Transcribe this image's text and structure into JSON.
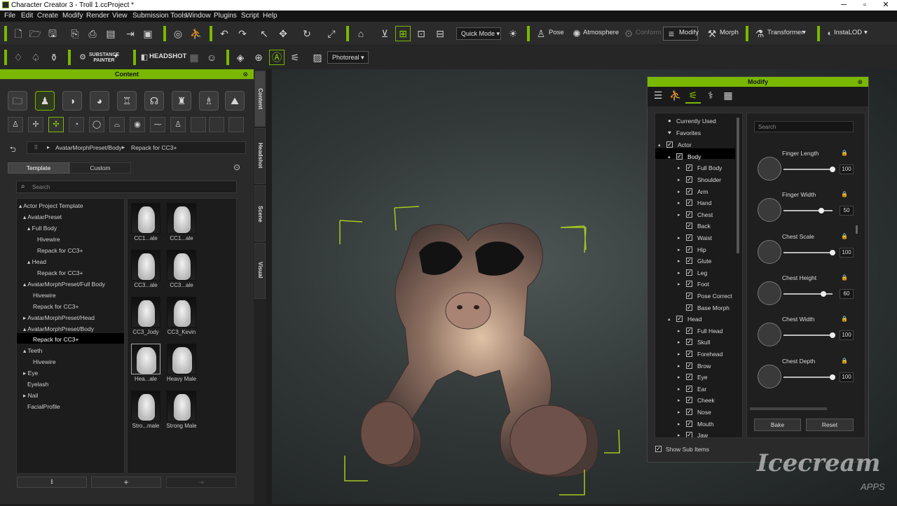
{
  "window": {
    "title": "Character Creator 3 - Troll 1.ccProject *"
  },
  "menu": [
    "File",
    "Edit",
    "Create",
    "Modify",
    "Render",
    "View",
    "Submission Tools",
    "Window",
    "Plugins",
    "Script",
    "Help"
  ],
  "toolbar1": {
    "quick_mode": "Quick Mode",
    "pose": "Pose",
    "atmosphere": "Atmosphere",
    "conform": "Conform",
    "modify": "Modify",
    "morph": "Morph",
    "transformer": "Transformer",
    "instalod": "InstaLOD"
  },
  "toolbar2": {
    "substance_1": "SUBSTANCE",
    "substance_2": "PAINTER",
    "headshot": "HEADSHOT",
    "render_mode": "Photoreal"
  },
  "content": {
    "title": "Content",
    "path_1": "AvatarMorphPreset/Body",
    "path_2": "Repack for CC3+",
    "tab_template": "Template",
    "tab_custom": "Custom",
    "search_placeholder": "Search",
    "tree": [
      {
        "label": "Actor Project Template",
        "arrow": "▴"
      },
      {
        "label": "AvatarPreset",
        "arrow": "▴"
      },
      {
        "label": "Full Body",
        "arrow": "▴"
      },
      {
        "label": "Hivewire",
        "arrow": ""
      },
      {
        "label": "Repack for CC3+",
        "arrow": ""
      },
      {
        "label": "Head",
        "arrow": "▴"
      },
      {
        "label": "Repack for CC3+",
        "arrow": ""
      },
      {
        "label": "AvatarMorphPreset/Full Body",
        "arrow": "▴"
      },
      {
        "label": "Hivewire",
        "arrow": ""
      },
      {
        "label": "Repack for CC3+",
        "arrow": ""
      },
      {
        "label": "AvatarMorphPreset/Head",
        "arrow": "▸"
      },
      {
        "label": "AvatarMorphPreset/Body",
        "arrow": "▴"
      },
      {
        "label": "Repack for CC3+",
        "arrow": ""
      },
      {
        "label": "Teeth",
        "arrow": "▴"
      },
      {
        "label": "Hivewire",
        "arrow": ""
      },
      {
        "label": "Eye",
        "arrow": "▸"
      },
      {
        "label": "Eyelash",
        "arrow": ""
      },
      {
        "label": "Nail",
        "arrow": "▸"
      },
      {
        "label": "FacialProfile",
        "arrow": ""
      }
    ],
    "thumbs": [
      "CC1...ale",
      "CC1...ale",
      "CC3...ale",
      "CC3...ale",
      "CC3_Jody",
      "CC3_Kevin",
      "Hea...ale",
      "Heavy Male",
      "Stro...male",
      "Strong Male"
    ]
  },
  "side_tabs": [
    "Content",
    "Headshot",
    "Scene",
    "Visual"
  ],
  "modify": {
    "title": "Modify",
    "list": [
      {
        "label": "Currently Used",
        "kind": "bullet"
      },
      {
        "label": "Favorites",
        "kind": "heart"
      },
      {
        "label": "Actor",
        "kind": "check",
        "arrow": "▴"
      },
      {
        "label": "Body",
        "kind": "check",
        "arrow": "▴"
      },
      {
        "label": "Full Body",
        "kind": "check",
        "arrow": "▸"
      },
      {
        "label": "Shoulder",
        "kind": "check",
        "arrow": "▸"
      },
      {
        "label": "Arm",
        "kind": "check",
        "arrow": "▸"
      },
      {
        "label": "Hand",
        "kind": "check",
        "arrow": "▸"
      },
      {
        "label": "Chest",
        "kind": "check",
        "arrow": "▸"
      },
      {
        "label": "Back",
        "kind": "check",
        "arrow": ""
      },
      {
        "label": "Waist",
        "kind": "check",
        "arrow": "▸"
      },
      {
        "label": "Hip",
        "kind": "check",
        "arrow": "▸"
      },
      {
        "label": "Glute",
        "kind": "check",
        "arrow": "▸"
      },
      {
        "label": "Leg",
        "kind": "check",
        "arrow": "▸"
      },
      {
        "label": "Foot",
        "kind": "check",
        "arrow": "▸"
      },
      {
        "label": "Pose Correct",
        "kind": "check",
        "arrow": ""
      },
      {
        "label": "Base Morph",
        "kind": "check",
        "arrow": ""
      },
      {
        "label": "Head",
        "kind": "check",
        "arrow": "▴"
      },
      {
        "label": "Full Head",
        "kind": "check",
        "arrow": "▸"
      },
      {
        "label": "Skull",
        "kind": "check",
        "arrow": "▸"
      },
      {
        "label": "Forehead",
        "kind": "check",
        "arrow": "▸"
      },
      {
        "label": "Brow",
        "kind": "check",
        "arrow": "▸"
      },
      {
        "label": "Eye",
        "kind": "check",
        "arrow": "▸"
      },
      {
        "label": "Ear",
        "kind": "check",
        "arrow": "▸"
      },
      {
        "label": "Cheek",
        "kind": "check",
        "arrow": "▸"
      },
      {
        "label": "Nose",
        "kind": "check",
        "arrow": "▸"
      },
      {
        "label": "Mouth",
        "kind": "check",
        "arrow": "▸"
      },
      {
        "label": "Jaw",
        "kind": "check",
        "arrow": "▸"
      }
    ],
    "search_placeholder": "Search",
    "sliders": [
      {
        "name": "Finger Length",
        "value": "100",
        "level": 1.0
      },
      {
        "name": "Finger Width",
        "value": "50",
        "level": 0.75
      },
      {
        "name": "Chest Scale",
        "value": "100",
        "level": 1.0
      },
      {
        "name": "Chest Height",
        "value": "60",
        "level": 0.8
      },
      {
        "name": "Chest Width",
        "value": "100",
        "level": 1.0
      },
      {
        "name": "Chest Depth",
        "value": "100",
        "level": 1.0
      }
    ],
    "show_sub_items": "Show Sub Items",
    "bake": "Bake",
    "reset": "Reset"
  },
  "watermark": {
    "brand": "Icecream",
    "sub": "APPS"
  },
  "colors": {
    "accent": "#7ab800"
  }
}
